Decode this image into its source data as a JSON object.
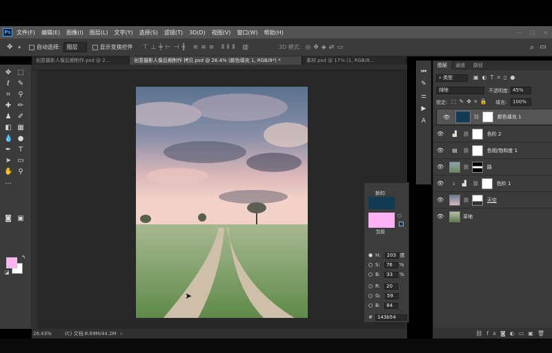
{
  "app": {
    "logo": "Ps"
  },
  "menu": {
    "items": [
      "文件(F)",
      "编辑(E)",
      "图像(I)",
      "图层(L)",
      "文字(Y)",
      "选择(S)",
      "滤镜(T)",
      "3D(D)",
      "视图(V)",
      "窗口(W)",
      "帮助(H)"
    ]
  },
  "options": {
    "auto_select_label": "自动选择:",
    "auto_select_value": "图层",
    "transform_label": "显示变换控件",
    "mode_3d_label": "3D 模式:"
  },
  "tabs": [
    {
      "label": "创意摄影人像后期制作.psd @ 2...",
      "active": false
    },
    {
      "label": "创意摄影人像后期制作 拷贝.psd @ 26.4% (颜色填充 1, RGB/8*) *",
      "active": true
    },
    {
      "label": "素材.psd @ 17% (1, RGB/8...",
      "active": false
    }
  ],
  "status": {
    "zoom": "26.43%",
    "doc": "(C) 文档:8.69M/44.2M"
  },
  "color_popup": {
    "new_label": "新的",
    "current_label": "当前",
    "new_color": "#143b54",
    "current_color": "#ffb3f5",
    "fields": [
      {
        "key": "H:",
        "value": "203",
        "unit": "度"
      },
      {
        "key": "S:",
        "value": "76",
        "unit": "%"
      },
      {
        "key": "B:",
        "value": "33",
        "unit": "%"
      },
      {
        "key": "R:",
        "value": "20",
        "unit": ""
      },
      {
        "key": "G:",
        "value": "59",
        "unit": ""
      },
      {
        "key": "B:",
        "value": "84",
        "unit": ""
      }
    ],
    "hex_label": "#",
    "hex_value": "143b54"
  },
  "layers_panel": {
    "tabs": [
      "图层",
      "通道",
      "路径"
    ],
    "filter_label": "类型",
    "blend_mode": "排除",
    "opacity_label": "不透明度:",
    "opacity_value": "45%",
    "lock_label": "锁定:",
    "fill_label": "填充:",
    "fill_value": "100%",
    "layers": [
      {
        "name": "颜色填充 1",
        "kind": "fill",
        "selected": true
      },
      {
        "name": "色阶 2",
        "kind": "levels",
        "selected": false
      },
      {
        "name": "色相/饱和度 1",
        "kind": "hue",
        "selected": false
      },
      {
        "name": "路",
        "kind": "image-mask",
        "selected": false
      },
      {
        "name": "色阶 1",
        "kind": "levels-clip",
        "selected": false
      },
      {
        "name": "天空",
        "kind": "sky",
        "selected": false
      },
      {
        "name": "草地",
        "kind": "grass",
        "selected": false
      }
    ]
  },
  "colors": {
    "foreground": "#ffb3f5",
    "background": "#ffffff",
    "accent": "#31a8ff"
  }
}
